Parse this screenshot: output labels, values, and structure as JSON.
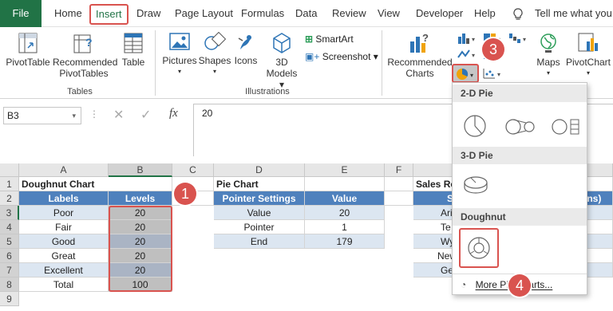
{
  "tabs": {
    "file": "File",
    "home": "Home",
    "insert": "Insert",
    "draw": "Draw",
    "page_layout": "Page Layout",
    "formulas": "Formulas",
    "data": "Data",
    "review": "Review",
    "view": "View",
    "developer": "Developer",
    "help": "Help",
    "tell_me": "Tell me what you w"
  },
  "ribbon": {
    "pivot_table": "PivotTable",
    "recommended_pivot_1": "Recommended",
    "recommended_pivot_2": "PivotTables",
    "table": "Table",
    "group_tables": "Tables",
    "pictures": "Pictures",
    "shapes": "Shapes",
    "icons": "Icons",
    "models_1": "3D",
    "models_2": "Models",
    "smartart": "SmartArt",
    "screenshot": "Screenshot",
    "group_illustrations": "Illustrations",
    "rec_charts_1": "Recommended",
    "rec_charts_2": "Charts",
    "maps": "Maps",
    "pivotchart": "PivotChart"
  },
  "formula_bar": {
    "name_box": "B3",
    "fx": "fx",
    "value": "20"
  },
  "columns": [
    "A",
    "B",
    "C",
    "D",
    "E",
    "F"
  ],
  "rows": [
    "1",
    "2",
    "3",
    "4",
    "5",
    "6",
    "7",
    "8",
    "9"
  ],
  "sheet": {
    "a1": "Doughnut Chart",
    "a2": "Labels",
    "b2": "Levels",
    "labels": [
      "Poor",
      "Fair",
      "Good",
      "Great",
      "Excellent",
      "Total"
    ],
    "levels": [
      "20",
      "20",
      "20",
      "20",
      "20",
      "100"
    ],
    "d1": "Pie Chart",
    "d2": "Pointer Settings",
    "e2": "Value",
    "pointer_labels": [
      "Value",
      "Pointer",
      "End"
    ],
    "pointer_values": [
      "20",
      "1",
      "179"
    ],
    "g1": "Sales Re",
    "g2_left": "St",
    "g2_right": "ons)",
    "g_cells": [
      "Ari",
      "Te",
      "Wy",
      "New",
      "Ge"
    ]
  },
  "dropdown": {
    "pie_2d": "2-D Pie",
    "pie_3d": "3-D Pie",
    "doughnut": "Doughnut",
    "more": "More Pie Charts..."
  },
  "badges": [
    "1",
    "2",
    "3",
    "4"
  ],
  "colors": {
    "excel_green": "#217346",
    "header_blue": "#4f81bd",
    "light_blue": "#dce6f1",
    "highlight_red": "#d9534f",
    "selected_gray": "#bfbfbf"
  }
}
